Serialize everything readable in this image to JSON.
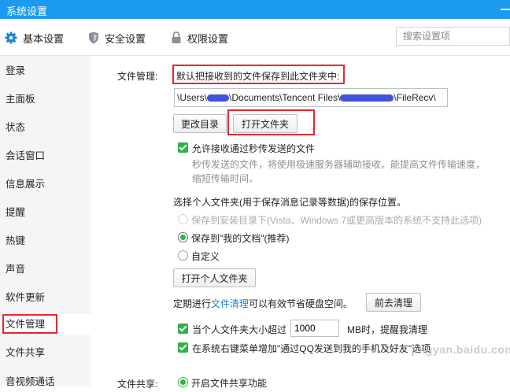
{
  "window": {
    "title": "系统设置"
  },
  "tabs": [
    {
      "label": "基本设置",
      "icon": "gear-icon"
    },
    {
      "label": "安全设置",
      "icon": "shield-icon"
    },
    {
      "label": "权限设置",
      "icon": "lock-icon"
    }
  ],
  "search": {
    "placeholder": "搜索设置项"
  },
  "sidebar": {
    "items": [
      {
        "label": "登录"
      },
      {
        "label": "主面板"
      },
      {
        "label": "状态"
      },
      {
        "label": "会话窗口"
      },
      {
        "label": "信息展示"
      },
      {
        "label": "提醒"
      },
      {
        "label": "热键"
      },
      {
        "label": "声音"
      },
      {
        "label": "软件更新"
      },
      {
        "label": "文件管理"
      },
      {
        "label": "文件共享"
      },
      {
        "label": "音视频通话"
      }
    ],
    "active": "文件管理"
  },
  "file_management": {
    "section_label": "文件管理:",
    "default_folder_text": "默认把接收到的文件保存到此文件夹中:",
    "path_parts": [
      "\\Users\\",
      "\\Documents\\Tencent Files\\",
      "\\FileRecv\\"
    ],
    "change_dir_button": "更改目录",
    "open_folder_button": "打开文件夹",
    "allow_instant_label": "允许接收通过秒传发送的文件",
    "instant_desc": "秒传发送的文件，将使用极速服务器辅助接收。能提高文件传输速度，缩短传输时间。",
    "personal_folder_prompt": "选择个人文件夹(用于保存消息记录等数据)的保存位置。",
    "option_install_dir": "保存到安装目录下(Vista、Windows 7或更高版本的系统不支持此选项)",
    "option_my_documents": "保存到\"我的文档\"(推荐)",
    "option_custom": "自定义",
    "open_personal_folder_button": "打开个人文件夹",
    "cleanup_prefix": "定期进行",
    "cleanup_link": "文件清理",
    "cleanup_suffix": "可以有效节省硬盘空间。",
    "cleanup_button": "前去清理",
    "size_limit_prefix": "当个人文件夹大小超过",
    "size_limit_value": "1000",
    "size_limit_suffix": "MB时，提醒我清理",
    "context_menu_label": "在系统右键菜单增加\"通过QQ发送到我的手机及好友\"选项"
  },
  "file_sharing": {
    "section_label": "文件共享:",
    "enable_label": "开启文件共享功能"
  },
  "watermark": {
    "text": "jingyan.baidu.com"
  },
  "colors": {
    "title_bar": "#1b9af0",
    "accent_green": "#2fb24a",
    "highlight_red": "#e8262d",
    "link": "#1e7fd6"
  }
}
